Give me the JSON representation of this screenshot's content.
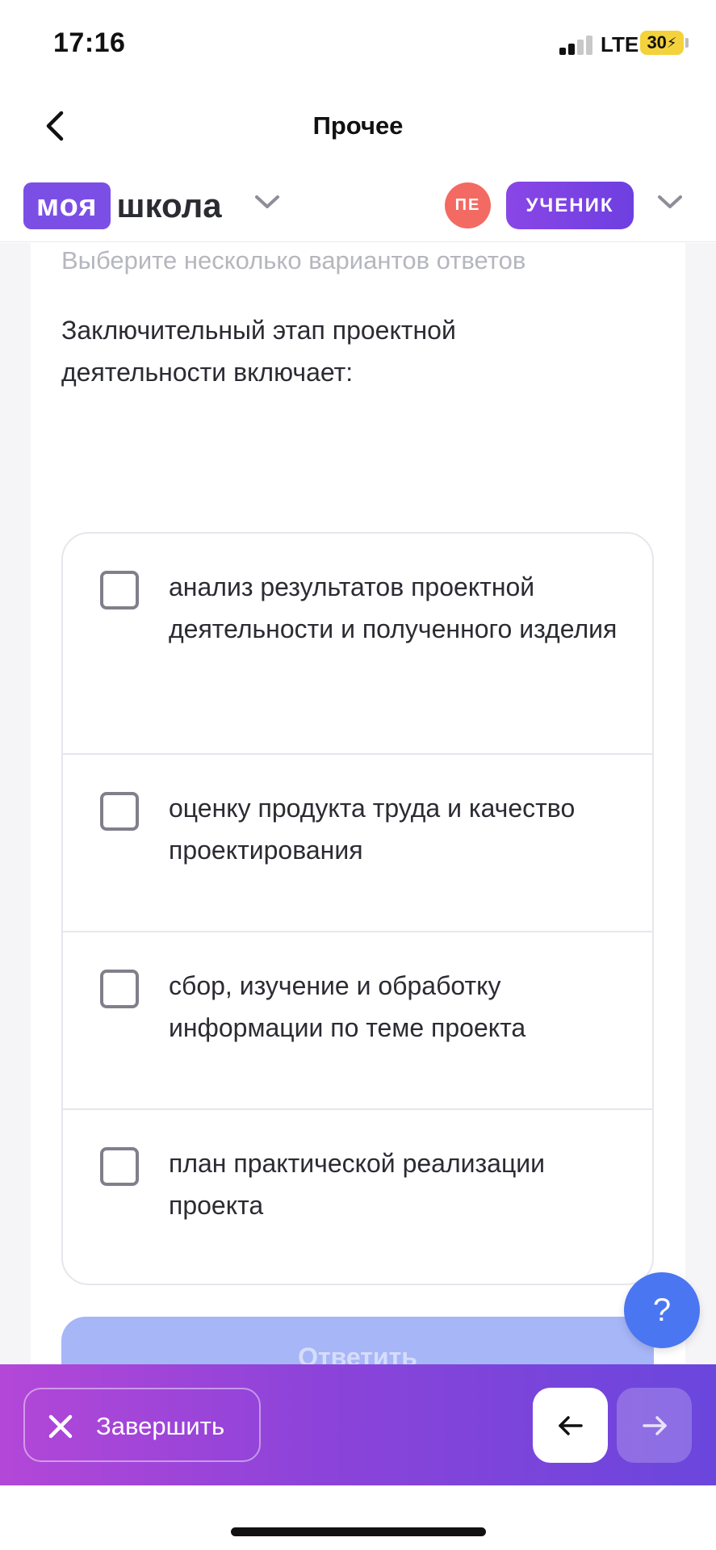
{
  "status_bar": {
    "time": "17:16",
    "network": "LTE",
    "battery": "30"
  },
  "navbar": {
    "title": "Прочее",
    "back_icon": "chevron-left-icon"
  },
  "brand": {
    "logo_box": "моя",
    "logo_text": "школа",
    "avatar_initials": "ПЕ",
    "role": "УЧЕНИК",
    "colors": {
      "logo": "#7b4fe6",
      "avatar": "#f36a63",
      "role": "#7b44e3"
    }
  },
  "quiz": {
    "hint": "Выберите несколько вариантов ответов",
    "question": "Заключительный этап проектной деятельности включает:",
    "options": [
      {
        "label": "анализ результатов проектной деятельности и полученного изделия",
        "checked": false
      },
      {
        "label": "оценку продукта труда и качество проектирования",
        "checked": false
      },
      {
        "label": "сбор, изучение и обработку информации по теме проекта",
        "checked": false
      },
      {
        "label": "план практической реализации проекта",
        "checked": false
      }
    ],
    "submit_label": "Ответить"
  },
  "help": {
    "label": "?"
  },
  "bottom_bar": {
    "finish_label": "Завершить",
    "finish_icon": "close-icon",
    "prev_icon": "arrow-left-icon",
    "next_icon": "arrow-right-icon"
  }
}
